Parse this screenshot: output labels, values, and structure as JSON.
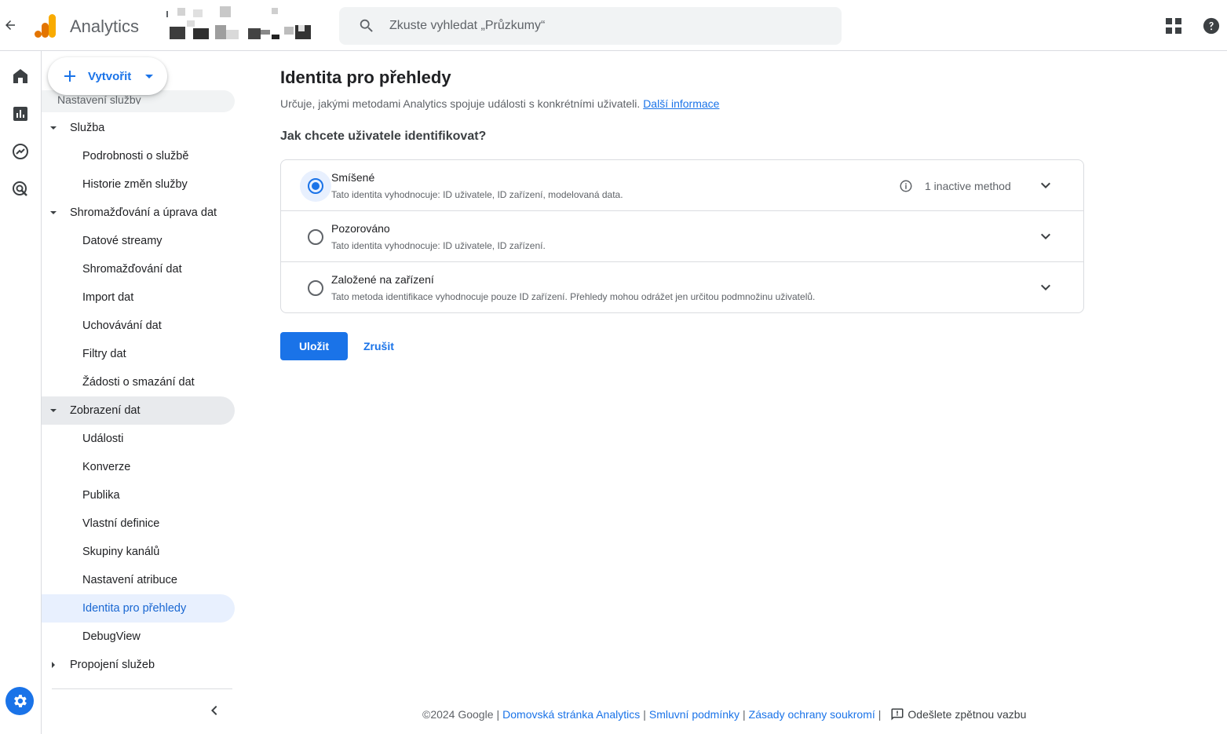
{
  "header": {
    "app_name": "Analytics",
    "search_placeholder": "Zkuste vyhledat „Průzkumy“",
    "brand_colors": {
      "logo_orange": "#f9ab00",
      "logo_dark_orange": "#e37400"
    }
  },
  "create_button": {
    "label": "Vytvořit"
  },
  "sidebar": {
    "partial_item": "Nastavení služby",
    "items": [
      {
        "label": "Služba",
        "type": "group"
      },
      {
        "label": "Podrobnosti o službě",
        "type": "child"
      },
      {
        "label": "Historie změn služby",
        "type": "child"
      },
      {
        "label": "Shromažďování a úprava dat",
        "type": "group"
      },
      {
        "label": "Datové streamy",
        "type": "child"
      },
      {
        "label": "Shromažďování dat",
        "type": "child"
      },
      {
        "label": "Import dat",
        "type": "child"
      },
      {
        "label": "Uchovávání dat",
        "type": "child"
      },
      {
        "label": "Filtry dat",
        "type": "child"
      },
      {
        "label": "Žádosti o smazání dat",
        "type": "child"
      },
      {
        "label": "Zobrazení dat",
        "type": "group"
      },
      {
        "label": "Události",
        "type": "child"
      },
      {
        "label": "Konverze",
        "type": "child"
      },
      {
        "label": "Publika",
        "type": "child"
      },
      {
        "label": "Vlastní definice",
        "type": "child"
      },
      {
        "label": "Skupiny kanálů",
        "type": "child"
      },
      {
        "label": "Nastavení atribuce",
        "type": "child"
      },
      {
        "label": "Identita pro přehledy",
        "type": "child"
      },
      {
        "label": "DebugView",
        "type": "child"
      },
      {
        "label": "Propojení služeb",
        "type": "group"
      }
    ]
  },
  "main": {
    "title": "Identita pro přehledy",
    "description": "Určuje, jakými metodami Analytics spojuje události s konkrétními uživateli.",
    "learn_more": "Další informace",
    "question": "Jak chcete uživatele identifikovat?",
    "options": [
      {
        "title": "Smíšené",
        "description": "Tato identita vyhodnocuje: ID uživatele, ID zařízení, modelovaná data.",
        "status": "1 inactive method",
        "selected": true
      },
      {
        "title": "Pozorováno",
        "description": "Tato identita vyhodnocuje: ID uživatele, ID zařízení.",
        "status": "",
        "selected": false
      },
      {
        "title": "Založené na zařízení",
        "description": "Tato metoda identifikace vyhodnocuje pouze ID zařízení. Přehledy mohou odrážet jen určitou podmnožinu uživatelů.",
        "status": "",
        "selected": false
      }
    ],
    "save_label": "Uložit",
    "cancel_label": "Zrušit",
    "accent_color": "#1a73e8"
  },
  "footer": {
    "copyright": "©2024 Google",
    "links": [
      "Domovská stránka Analytics",
      "Smluvní podmínky",
      "Zásady ochrany soukromí"
    ],
    "feedback": "Odešlete zpětnou vazbu"
  }
}
